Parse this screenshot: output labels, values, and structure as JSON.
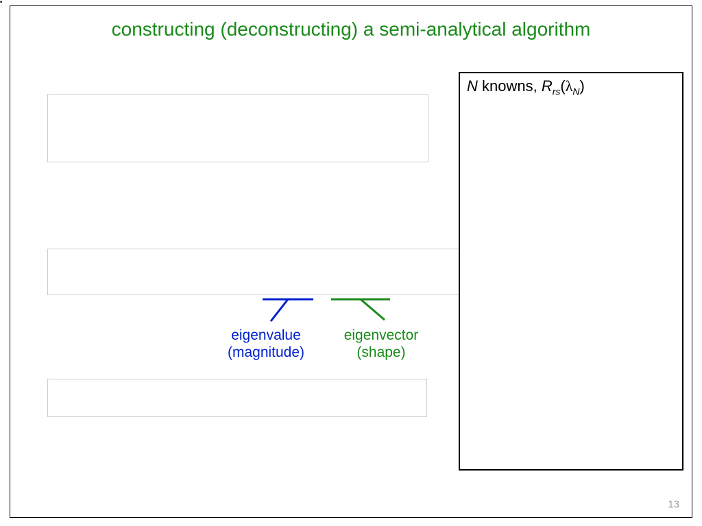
{
  "slide": {
    "title": "constructing (deconstructing) a semi-analytical algorithm",
    "page_number": "13"
  },
  "known_box": {
    "prefix_italic": "N",
    "text_mid": " knowns, ",
    "R": "R",
    "rs": "rs",
    "open": "(",
    "lambda": "λ",
    "N_sub": "N",
    "close": ")"
  },
  "eigen": {
    "value_l1": "eigenvalue",
    "value_l2": "(magnitude)",
    "vector_l1": "eigenvector",
    "vector_l2": "(shape)"
  },
  "colors": {
    "title_green": "#1a8a1a",
    "blue": "#0020d0",
    "green": "#1a8a1a"
  }
}
